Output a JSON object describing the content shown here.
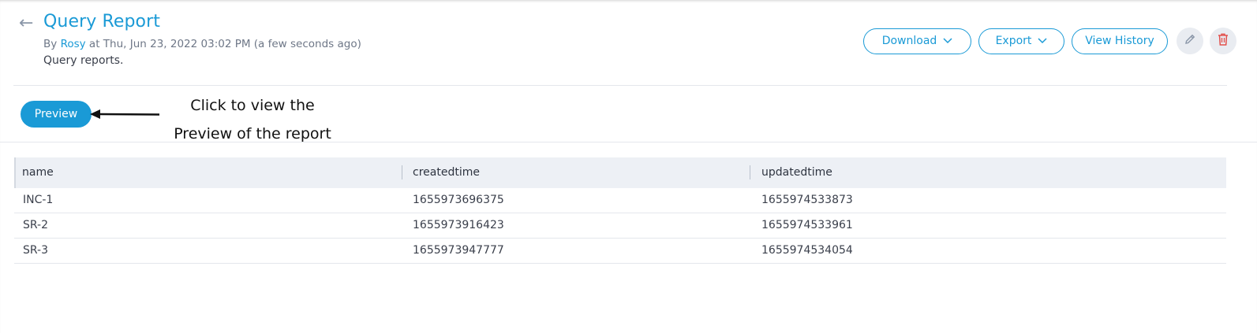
{
  "header": {
    "title": "Query Report",
    "by_prefix": "By",
    "user": "Rosy",
    "at_text": "at Thu, Jun 23, 2022 03:02 PM (a few seconds ago)",
    "description": "Query reports."
  },
  "actions": {
    "download_label": "Download",
    "export_label": "Export",
    "history_label": "View History"
  },
  "preview": {
    "button_label": "Preview",
    "annotation_line1": "Click to view  the",
    "annotation_line2": "Preview of the report"
  },
  "table": {
    "columns": [
      "name",
      "createdtime",
      "updatedtime"
    ],
    "rows": [
      [
        "INC-1",
        "1655973696375",
        "1655974533873"
      ],
      [
        "SR-2",
        "1655973916423",
        "1655974533961"
      ],
      [
        "SR-3",
        "1655973947777",
        "1655974534054"
      ]
    ]
  },
  "colors": {
    "accent": "#1a9ad6",
    "danger": "#e2504c",
    "header_bg": "#edf0f5"
  }
}
